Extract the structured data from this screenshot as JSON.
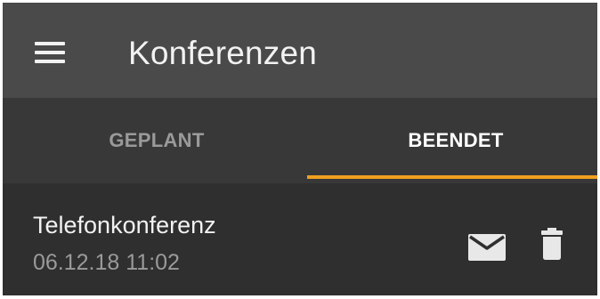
{
  "app_bar": {
    "title": "Konferenzen",
    "menu_icon": "menu-icon"
  },
  "tabs": [
    {
      "label": "GEPLANT",
      "selected": false
    },
    {
      "label": "BEENDET",
      "selected": true
    }
  ],
  "conferences": [
    {
      "title": "Telefonkonferenz",
      "datetime": "06.12.18 11:02",
      "actions": [
        "mail-icon",
        "trash-icon"
      ]
    }
  ],
  "colors": {
    "app_bar_bg": "#4a4a4a",
    "tab_bar_bg": "#383838",
    "list_bg": "#2f2f2f",
    "accent_indicator": "#f0a020",
    "text_primary": "#f2f2f2",
    "text_secondary": "#9a9a9a"
  }
}
